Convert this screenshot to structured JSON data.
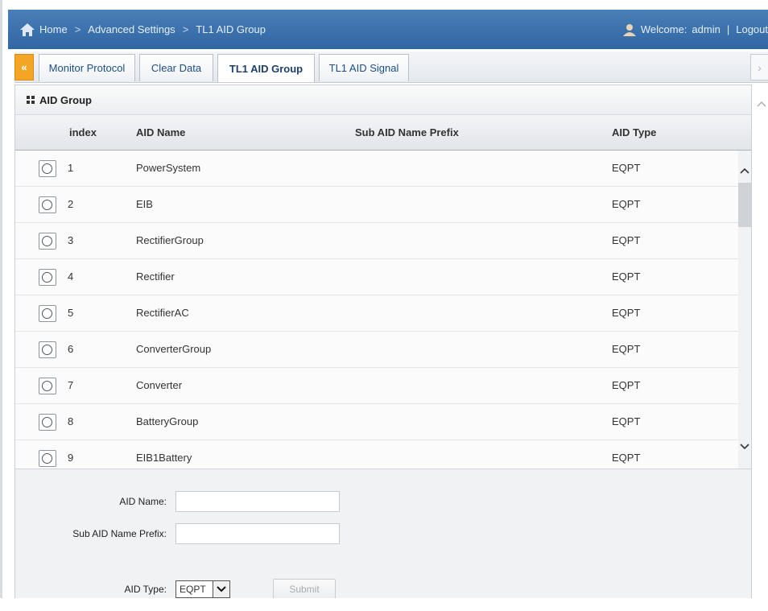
{
  "breadcrumb": {
    "home": "Home",
    "level1": "Advanced Settings",
    "level2": "TL1 AID Group",
    "separator": ">"
  },
  "user": {
    "welcome_label": "Welcome:",
    "name": "admin",
    "divider": "|",
    "logout": "Logout"
  },
  "tabs": [
    {
      "label": "Monitor Protocol",
      "active": false
    },
    {
      "label": "Clear Data",
      "active": false
    },
    {
      "label": "TL1 AID Group",
      "active": true
    },
    {
      "label": "TL1 AID Signal",
      "active": false
    }
  ],
  "panel": {
    "title": "AID Group"
  },
  "table": {
    "columns": [
      "index",
      "AID Name",
      "Sub AID Name Prefix",
      "AID Type"
    ],
    "rows": [
      {
        "index": "1",
        "name": "PowerSystem",
        "prefix": "",
        "type": "EQPT"
      },
      {
        "index": "2",
        "name": "EIB",
        "prefix": "",
        "type": "EQPT"
      },
      {
        "index": "3",
        "name": "RectifierGroup",
        "prefix": "",
        "type": "EQPT"
      },
      {
        "index": "4",
        "name": "Rectifier",
        "prefix": "",
        "type": "EQPT"
      },
      {
        "index": "5",
        "name": "RectifierAC",
        "prefix": "",
        "type": "EQPT"
      },
      {
        "index": "6",
        "name": "ConverterGroup",
        "prefix": "",
        "type": "EQPT"
      },
      {
        "index": "7",
        "name": "Converter",
        "prefix": "",
        "type": "EQPT"
      },
      {
        "index": "8",
        "name": "BatteryGroup",
        "prefix": "",
        "type": "EQPT"
      },
      {
        "index": "9",
        "name": "EIB1Battery",
        "prefix": "",
        "type": "EQPT"
      }
    ]
  },
  "form": {
    "aid_name_label": "AID Name:",
    "aid_name_value": "",
    "prefix_label": "Sub AID Name Prefix:",
    "prefix_value": "",
    "aid_type_label": "AID Type:",
    "aid_type_value": "EQPT",
    "submit_label": "Submit"
  },
  "colors": {
    "topbar": "#3a71ad",
    "accent_tab": "#f3a623"
  }
}
